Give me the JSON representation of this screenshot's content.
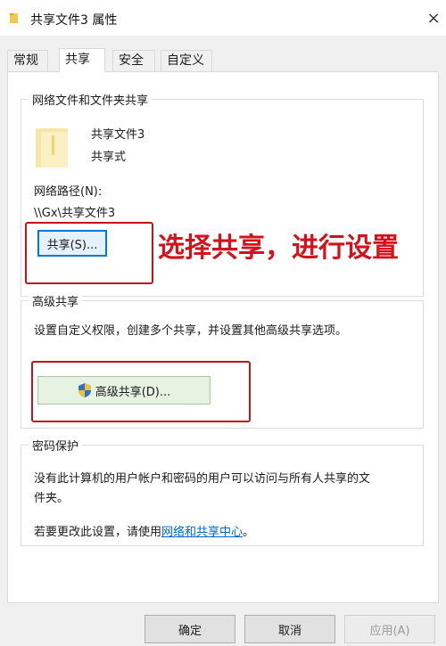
{
  "window": {
    "title": "共享文件3 属性",
    "close_glyph": "×"
  },
  "tabs": [
    {
      "label": "常规",
      "active": false
    },
    {
      "label": "共享",
      "active": true
    },
    {
      "label": "安全",
      "active": false
    },
    {
      "label": "自定义",
      "active": false
    }
  ],
  "network_sharing": {
    "group_title": "网络文件和文件夹共享",
    "folder_name": "共享文件3",
    "status": "共享式",
    "path_label": "网络路径(N):",
    "path_value": "\\\\Gx\\共享文件3",
    "share_button_label": "共享(S)..."
  },
  "annotation": {
    "text": "选择共享，进行设置",
    "color": "#d4121b"
  },
  "advanced_sharing": {
    "group_title": "高级共享",
    "description": "设置自定义权限，创建多个共享，并设置其他高级共享选项。",
    "button_label": "高级共享(D)...",
    "button_icon": "uac-shield-icon"
  },
  "password_protection": {
    "group_title": "密码保护",
    "description_line1": "没有此计算机的用户帐户和密码的用户可以访问与所有人共享的文",
    "description_line2": "件夹。",
    "change_prefix": "若要更改此设置，请使用",
    "change_link": "网络和共享中心",
    "change_suffix": "。"
  },
  "footer": {
    "ok_label": "确定",
    "cancel_label": "取消",
    "apply_label": "应用(A)"
  },
  "colors": {
    "accent_red": "#c3141b",
    "link_blue": "#0066cc",
    "focus_blue": "#0078d7",
    "folder_yellow": "#f4dc8a"
  }
}
